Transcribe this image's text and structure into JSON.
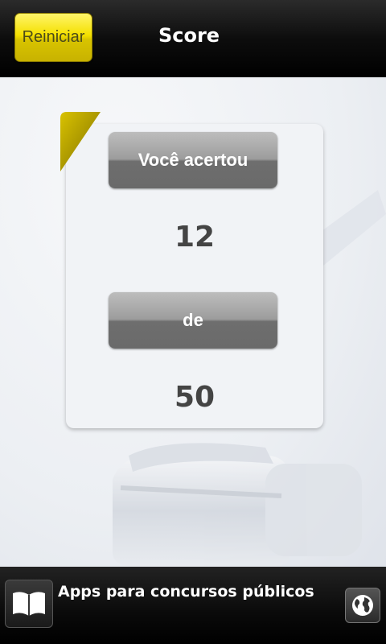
{
  "header": {
    "restart_label": "Reiniciar",
    "title": "Score"
  },
  "score": {
    "correct_label": "Você acertou",
    "correct_value": "12",
    "of_label": "de",
    "total_value": "50"
  },
  "ad": {
    "text": "Apps para concursos públicos",
    "book_icon": "book-icon",
    "globe_icon": "globe-icon"
  },
  "colors": {
    "accent": "#f4e000",
    "pill": "#8a8a8a"
  }
}
